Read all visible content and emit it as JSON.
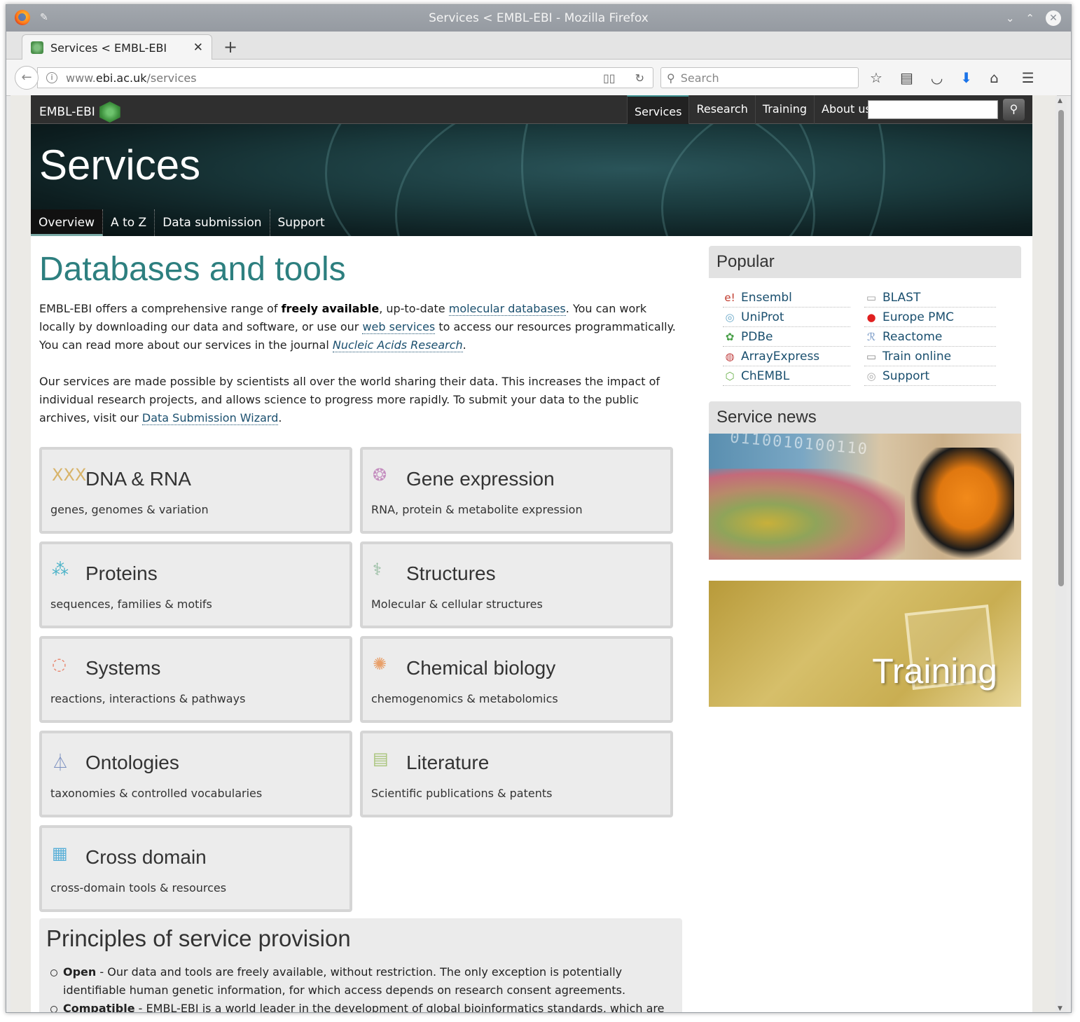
{
  "window": {
    "title": "Services < EMBL-EBI - Mozilla Firefox"
  },
  "tab": {
    "label": "Services < EMBL-EBI"
  },
  "urlbar": {
    "scheme_prefix": "www.",
    "host": "ebi.ac.uk",
    "path": "/services"
  },
  "searchbar": {
    "placeholder": "Search"
  },
  "site": {
    "logo_text": "EMBL-EBI",
    "topnav": [
      "Services",
      "Research",
      "Training",
      "About us"
    ],
    "banner_title": "Services",
    "subnav": [
      "Overview",
      "A to Z",
      "Data submission",
      "Support"
    ]
  },
  "main": {
    "heading": "Databases and tools",
    "p1": {
      "t1": "EMBL-EBI offers a comprehensive range of ",
      "b1": "freely available",
      "t2": ", up-to-date ",
      "l1": "molecular databases",
      "t3": ". You can work locally by downloading our data and software, or use our ",
      "l2": "web services",
      "t4": " to access our resources programmatically. You can read more about our services in the journal ",
      "l3": "Nucleic Acids Research",
      "t5": "."
    },
    "p2": {
      "t1": "Our services are made possible by scientists all over the world sharing their data. This increases the impact of individual research projects, and allows science to progress more rapidly. To submit your data to the public archives, visit our ",
      "l1": "Data Submission Wizard",
      "t2": "."
    },
    "cards": [
      {
        "title": "DNA & RNA",
        "sub": "genes, genomes & variation",
        "icon": "dna-icon",
        "glyph": "ⅩⅩⅩ",
        "color": "#d8b46a"
      },
      {
        "title": "Gene expression",
        "sub": "RNA, protein & metabolite expression",
        "icon": "gene-expression-icon",
        "glyph": "❂",
        "color": "#c58fc0"
      },
      {
        "title": "Proteins",
        "sub": "sequences, families & motifs",
        "icon": "proteins-icon",
        "glyph": "⁂",
        "color": "#4cb3c8"
      },
      {
        "title": "Structures",
        "sub": "Molecular & cellular structures",
        "icon": "structures-icon",
        "glyph": "⚕",
        "color": "#8fb89a"
      },
      {
        "title": "Systems",
        "sub": "reactions, interactions & pathways",
        "icon": "systems-icon",
        "glyph": "◌",
        "color": "#e8836a"
      },
      {
        "title": "Chemical biology",
        "sub": "chemogenomics & metabolomics",
        "icon": "chemical-biology-icon",
        "glyph": "✺",
        "color": "#e8a06a"
      },
      {
        "title": "Ontologies",
        "sub": "taxonomies & controlled vocabularies",
        "icon": "ontologies-icon",
        "glyph": "⏃",
        "color": "#7a8fc0"
      },
      {
        "title": "Literature",
        "sub": "Scientific publications & patents",
        "icon": "literature-icon",
        "glyph": "▤",
        "color": "#a8c47a"
      },
      {
        "title": "Cross domain",
        "sub": "cross-domain tools & resources",
        "icon": "cross-domain-icon",
        "glyph": "▦",
        "color": "#5ab0d8"
      }
    ],
    "principles": {
      "heading": "Principles of service provision",
      "items": [
        {
          "bold": "Open",
          "text": " - Our data and tools are freely available, without restriction. The only exception is potentially identifiable human genetic information, for which access depends on research consent agreements."
        },
        {
          "bold": "Compatible",
          "text": " - EMBL-EBI is a world leader in the development of global bioinformatics standards, which are key to"
        }
      ]
    }
  },
  "sidebar": {
    "popular_heading": "Popular",
    "popular_left": [
      {
        "label": "Ensembl",
        "icon": "ensembl-icon",
        "glyph": "e!",
        "color": "#c0392b"
      },
      {
        "label": "UniProt",
        "icon": "uniprot-icon",
        "glyph": "◎",
        "color": "#6aa8c8"
      },
      {
        "label": "PDBe",
        "icon": "pdbe-icon",
        "glyph": "✿",
        "color": "#4aa04a"
      },
      {
        "label": "ArrayExpress",
        "icon": "arrayexpress-icon",
        "glyph": "◍",
        "color": "#c04040"
      },
      {
        "label": "ChEMBL",
        "icon": "chembl-icon",
        "glyph": "⬡",
        "color": "#6ab04a"
      }
    ],
    "popular_right": [
      {
        "label": "BLAST",
        "icon": "blast-icon",
        "glyph": "▭",
        "color": "#999999"
      },
      {
        "label": "Europe PMC",
        "icon": "europe-pmc-icon",
        "glyph": "●",
        "color": "#e02020"
      },
      {
        "label": "Reactome",
        "icon": "reactome-icon",
        "glyph": "ℛ",
        "color": "#6a8fc0"
      },
      {
        "label": "Train online",
        "icon": "train-online-icon",
        "glyph": "▭",
        "color": "#888888"
      },
      {
        "label": "Support",
        "icon": "support-icon",
        "glyph": "◎",
        "color": "#aaaaaa"
      }
    ],
    "news_heading": "Service news",
    "news_digits": "0110010100110",
    "training_label": "Training"
  }
}
